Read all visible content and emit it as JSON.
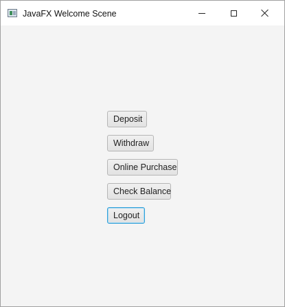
{
  "window": {
    "title": "JavaFX Welcome Scene",
    "controls": {
      "minimize": "minimize-icon",
      "maximize": "maximize-icon",
      "close": "close-icon"
    }
  },
  "menu": {
    "buttons": [
      {
        "label": "Deposit"
      },
      {
        "label": "Withdraw"
      },
      {
        "label": "Online Purchase"
      },
      {
        "label": "Check Balance"
      },
      {
        "label": "Logout",
        "focused": true
      }
    ]
  },
  "colors": {
    "background": "#f4f4f4",
    "titlebar": "#ffffff",
    "focus_border": "#2e9fd8"
  }
}
